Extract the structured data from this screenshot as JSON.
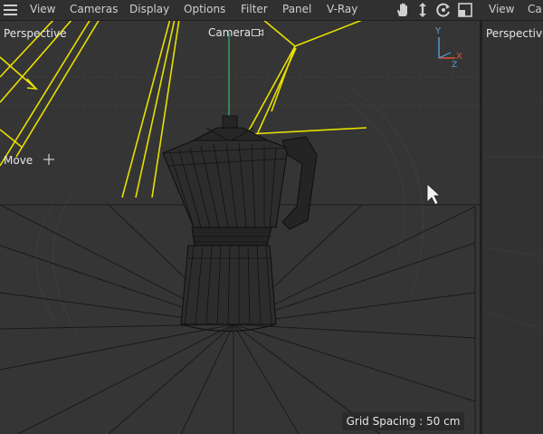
{
  "menubar": {
    "items": [
      {
        "label": "View"
      },
      {
        "label": "Cameras"
      },
      {
        "label": "Display"
      },
      {
        "label": "Options"
      },
      {
        "label": "Filter"
      },
      {
        "label": "Panel"
      },
      {
        "label": "V-Ray"
      }
    ],
    "right_items": [
      {
        "label": "View"
      },
      {
        "label": "Ca"
      }
    ],
    "tools": [
      "pan-hand-icon",
      "move-arrows-icon",
      "rotate-orbit-icon",
      "maximize-viewport-icon"
    ]
  },
  "viewport_left": {
    "title": "Perspective",
    "camera_label": "Camera",
    "tool_label": "Move",
    "axis": {
      "y": "Y",
      "x": "X",
      "z": "Z"
    },
    "grid_spacing": "Grid Spacing : 50 cm"
  },
  "viewport_right": {
    "title": "Perspective"
  },
  "colors": {
    "wire_yellow": "#e8e000",
    "camera_line": "#3aa56a",
    "axis_y": "#5aa0d6",
    "axis_x": "#d8553a",
    "axis_z": "#5aa0d6"
  }
}
